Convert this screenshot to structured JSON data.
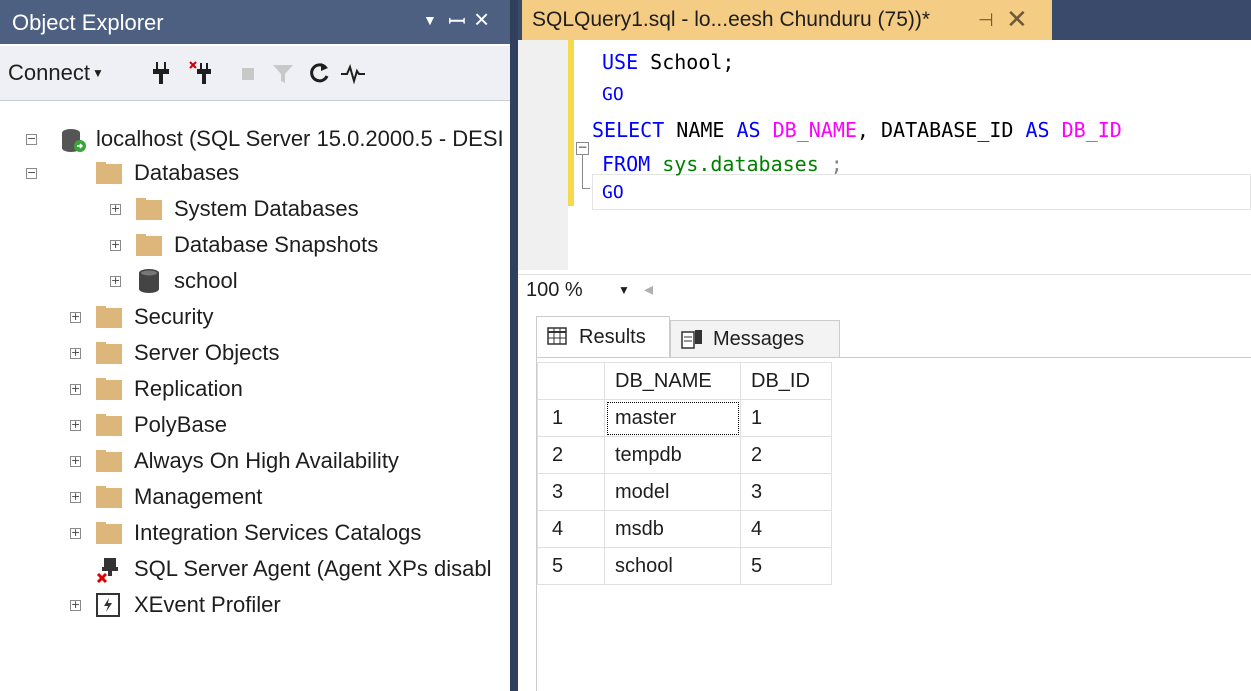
{
  "object_explorer": {
    "title": "Object Explorer",
    "title_controls": {
      "dropdown": "▾",
      "pin": "ᅟ",
      "close": "✕"
    },
    "toolbar": {
      "connect_label": "Connect"
    },
    "tree": [
      {
        "label": "localhost (SQL Server 15.0.2000.5 - DESI",
        "expander": "−"
      },
      {
        "label": "Databases",
        "expander": "−"
      },
      {
        "label": "System Databases",
        "expander": "+"
      },
      {
        "label": "Database Snapshots",
        "expander": "+"
      },
      {
        "label": "school",
        "expander": "+"
      },
      {
        "label": "Security",
        "expander": "+"
      },
      {
        "label": "Server Objects",
        "expander": "+"
      },
      {
        "label": "Replication",
        "expander": "+"
      },
      {
        "label": "PolyBase",
        "expander": "+"
      },
      {
        "label": "Always On High Availability",
        "expander": "+"
      },
      {
        "label": "Management",
        "expander": "+"
      },
      {
        "label": "Integration Services Catalogs",
        "expander": "+"
      },
      {
        "label": "SQL Server Agent (Agent XPs disabl",
        "expander": ""
      },
      {
        "label": "XEvent Profiler",
        "expander": "+"
      }
    ]
  },
  "query_tab": {
    "title": "SQLQuery1.sql - lo...eesh Chunduru (75))*",
    "pin": "⊣",
    "close": "✕"
  },
  "editor": {
    "lines": {
      "l1_kw": "USE",
      "l1_rest": " School;",
      "l2_kw": "GO",
      "l3_select": "SELECT",
      "l3_name": " NAME ",
      "l3_as1": "AS",
      "l3_alias1": " DB_NAME",
      "l3_comma": ", DATABASE_ID ",
      "l3_as2": "AS",
      "l3_alias2": " DB_ID",
      "l4_from": "FROM",
      "l4_obj": " sys.databases",
      "l4_semi": " ;",
      "l5_kw": "GO"
    }
  },
  "zoom": {
    "level": "100 %"
  },
  "result_tabs": {
    "results": "Results",
    "messages": "Messages"
  },
  "results_grid": {
    "columns": [
      "DB_NAME",
      "DB_ID"
    ],
    "rows": [
      {
        "n": "1",
        "name": "master",
        "id": "1"
      },
      {
        "n": "2",
        "name": "tempdb",
        "id": "2"
      },
      {
        "n": "3",
        "name": "model",
        "id": "3"
      },
      {
        "n": "4",
        "name": "msdb",
        "id": "4"
      },
      {
        "n": "5",
        "name": "school",
        "id": "5"
      }
    ]
  },
  "colors": {
    "oe_title": "#4d6082",
    "tab_active": "#f5cc84",
    "tabstrip": "#3a4a6a",
    "folder": "#dcb67a",
    "keyword": "#0000ff",
    "alias": "#ff00ff",
    "system_object": "#008000"
  }
}
